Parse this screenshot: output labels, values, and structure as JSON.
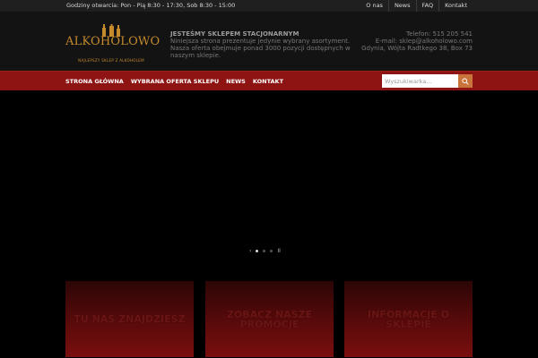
{
  "topbar": {
    "hours": "Godziny otwarcia: Pon - Pią 8:30 - 17:30, Sob 8:30 - 15:00",
    "links": [
      "O nas",
      "News",
      "FAQ",
      "Kontakt"
    ]
  },
  "logo": {
    "name": "ALKOHOLOWO",
    "tagline": "NAJLEPSZY SKLEP Z ALKOHOLEM"
  },
  "info": {
    "title": "JESTEŚMY SKLEPEM STACJONARNYM",
    "line1": "Niniejsza strona prezentuje jedynie wybrany asortyment.",
    "line2": "Nasza oferta obejmuje ponad 3000 pozycji dostępnych w naszym sklepie."
  },
  "contact": {
    "phone": "Telefon: 515 205 541",
    "email": "E-mail: sklep@alkoholowo.com",
    "address": "Gdynia, Wójta Radtkego 38, Box 73"
  },
  "nav": {
    "items": [
      "STRONA GŁÓWNA",
      "WYBRANA OFERTA SKLEPU",
      "NEWS",
      "KONTAKT"
    ]
  },
  "search": {
    "placeholder": "Wyszukiwarka..."
  },
  "slider": {
    "next": "›",
    "pause": "II",
    "active_index": 0
  },
  "promos": [
    "TU NAS ZNAJDZIESZ",
    "ZOBACZ NASZE PROMOCJE",
    "INFORMACJE O SKLEPIE"
  ],
  "colors": {
    "accent": "#8e1414",
    "logo": "#c48a2c",
    "search_button": "#c9743a"
  }
}
